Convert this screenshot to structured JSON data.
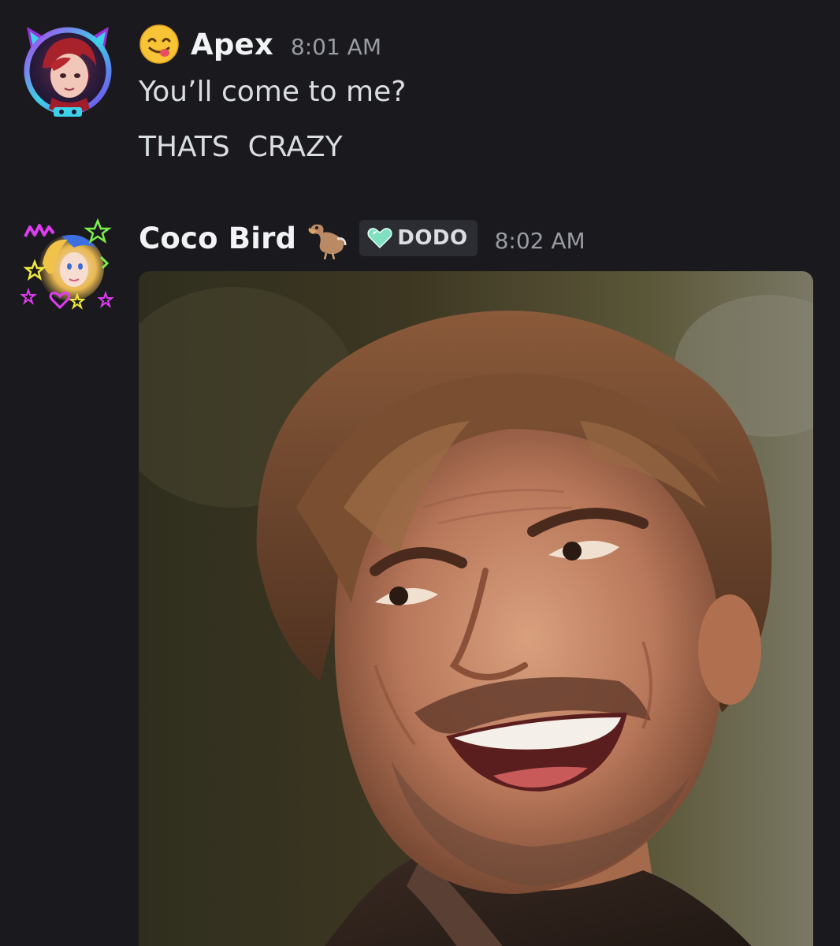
{
  "messages": [
    {
      "username": "Apex",
      "timestamp": "8:01 AM",
      "status_emoji": "yum-face-emoji",
      "lines": [
        "You’ll come to me?",
        "THATS  CRAZY"
      ]
    },
    {
      "username": "Coco Bird",
      "timestamp": "8:02 AM",
      "name_emoji": "dodo-bird-emoji",
      "tag": {
        "icon": "teal-heart-icon",
        "label": "DODO"
      },
      "attachment": "smiling-man-image"
    }
  ],
  "colors": {
    "background": "#1a1a1e",
    "username": "#f2f3f5",
    "message_text": "#dbdee1",
    "timestamp": "#9a9ca4",
    "tag_background": "#2c2d33",
    "tag_heart": "#7fe0c0"
  }
}
